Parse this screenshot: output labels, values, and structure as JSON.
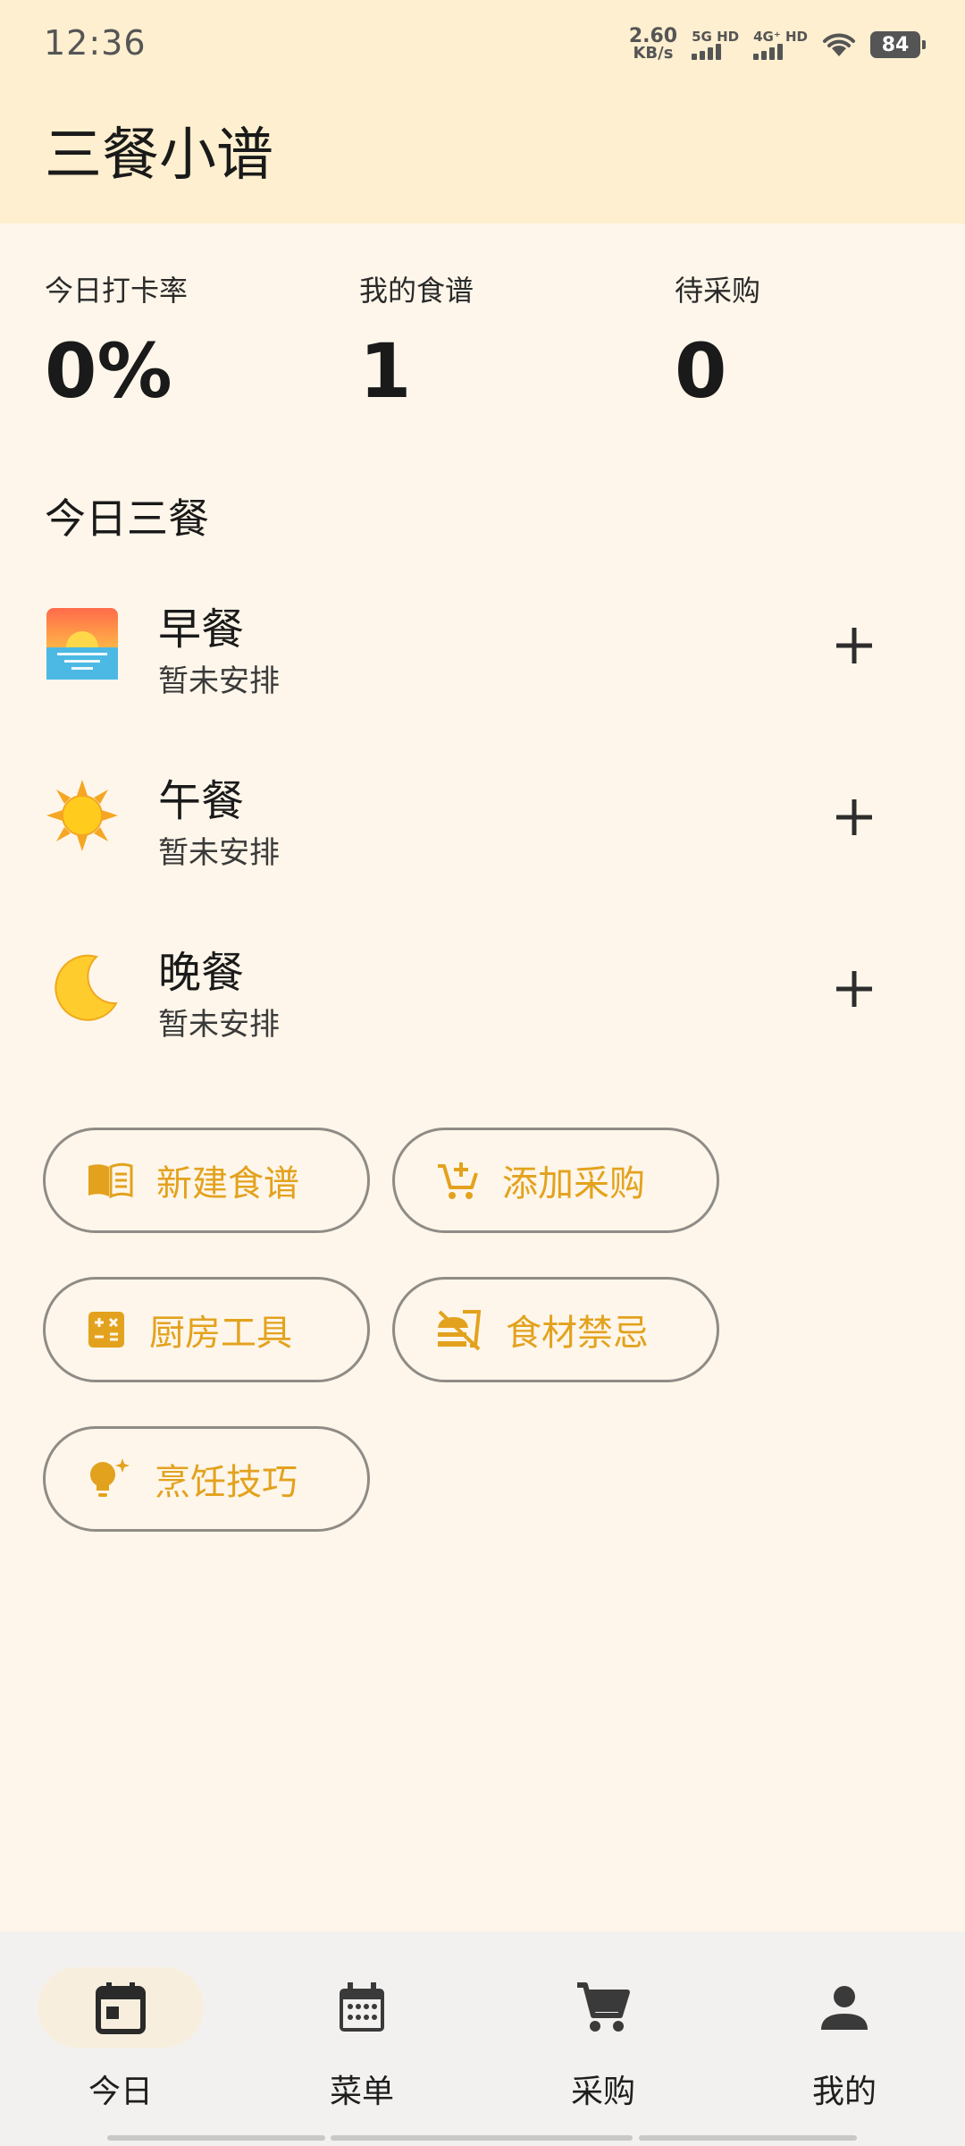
{
  "status_bar": {
    "time": "12:36",
    "net_speed_value": "2.60",
    "net_speed_unit": "KB/s",
    "sim1_tag": "5G HD",
    "sim2_tag": "4G⁺ HD",
    "battery": "84"
  },
  "header": {
    "title": "三餐小谱"
  },
  "stats": [
    {
      "label": "今日打卡率",
      "value": "0%"
    },
    {
      "label": "我的食谱",
      "value": "1"
    },
    {
      "label": "待采购",
      "value": "0"
    }
  ],
  "today": {
    "title": "今日三餐",
    "meals": [
      {
        "name": "早餐",
        "status": "暂未安排",
        "icon": "sunrise-icon"
      },
      {
        "name": "午餐",
        "status": "暂未安排",
        "icon": "sun-icon"
      },
      {
        "name": "晚餐",
        "status": "暂未安排",
        "icon": "moon-icon"
      }
    ]
  },
  "actions": [
    {
      "label": "新建食谱",
      "icon": "recipe-book-icon"
    },
    {
      "label": "添加采购",
      "icon": "add-cart-icon"
    },
    {
      "label": "厨房工具",
      "icon": "calculator-icon"
    },
    {
      "label": "食材禁忌",
      "icon": "no-food-icon"
    },
    {
      "label": "烹饪技巧",
      "icon": "lightbulb-icon"
    }
  ],
  "bottom_nav": [
    {
      "label": "今日",
      "icon": "today-calendar-icon",
      "active": true
    },
    {
      "label": "菜单",
      "icon": "calendar-grid-icon",
      "active": false
    },
    {
      "label": "采购",
      "icon": "cart-icon",
      "active": false
    },
    {
      "label": "我的",
      "icon": "person-icon",
      "active": false
    }
  ],
  "colors": {
    "header_bg": "#fdefcf",
    "page_bg": "#fef6ea",
    "accent": "#e3a21e",
    "nav_bg": "#f2f1ef"
  }
}
